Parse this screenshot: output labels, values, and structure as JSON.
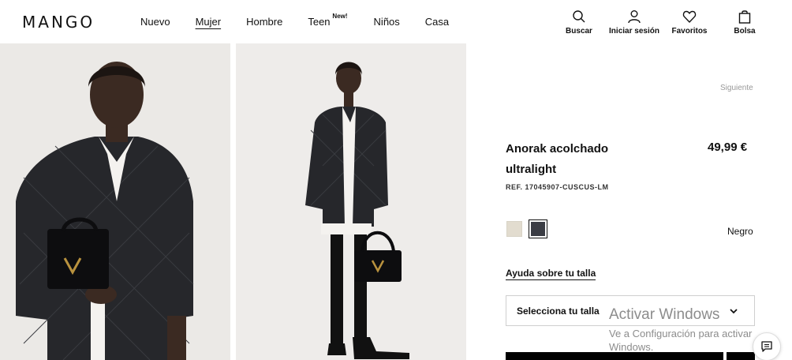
{
  "brand": {
    "logo": "MANGO"
  },
  "nav": {
    "items": [
      {
        "label": "Nuevo"
      },
      {
        "label": "Mujer",
        "active": true
      },
      {
        "label": "Hombre"
      },
      {
        "label": "Teen",
        "badge": "New!"
      },
      {
        "label": "Niños"
      },
      {
        "label": "Casa"
      }
    ]
  },
  "tools": {
    "search": {
      "label": "Buscar",
      "icon": "search-icon"
    },
    "login": {
      "label": "Iniciar sesión",
      "icon": "user-icon"
    },
    "favorites": {
      "label": "Favoritos",
      "icon": "heart-icon"
    },
    "bag": {
      "label": "Bolsa",
      "icon": "bag-icon"
    }
  },
  "product": {
    "next_label": "Siguiente",
    "title": "Anorak acolchado ultralight",
    "price": "49,99 €",
    "ref": "REF. 17045907-CUSCUS-LM",
    "colors": [
      {
        "name": "Beige",
        "hex": "#e2dccf"
      },
      {
        "name": "Negro",
        "hex": "#3b3d45",
        "selected": true
      }
    ],
    "selected_color_name": "Negro",
    "size_help": "Ayuda sobre tu talla",
    "size_select": {
      "label": "Selecciona tu talla"
    }
  },
  "watermark": {
    "title": "Activar Windows",
    "subtitle": "Ve a Configuración para activar Windows."
  },
  "colors": {
    "text": "#111111",
    "button": "#000000",
    "muted": "#999999"
  }
}
